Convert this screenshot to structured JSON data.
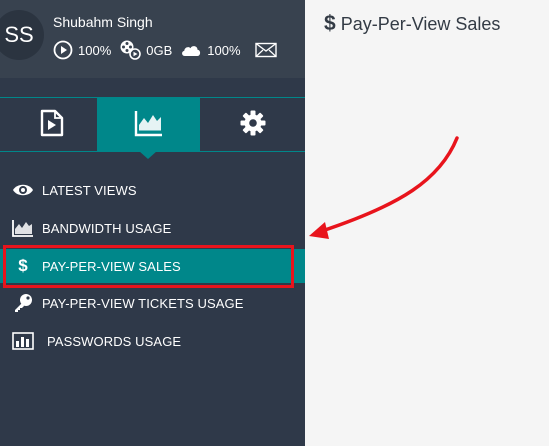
{
  "user": {
    "initials": "SS",
    "name": "Shubahm Singh",
    "video_quota": "100%",
    "bandwidth": "0GB",
    "storage": "100%"
  },
  "tabs": [
    {
      "name": "videos",
      "icon": "play-file-icon",
      "active": false
    },
    {
      "name": "analytics",
      "icon": "area-chart-icon",
      "active": true
    },
    {
      "name": "settings",
      "icon": "gear-icon",
      "active": false
    }
  ],
  "menu": {
    "items": [
      {
        "label": "LATEST VIEWS",
        "icon": "eye-icon",
        "active": false
      },
      {
        "label": "BANDWIDTH USAGE",
        "icon": "area-chart-icon",
        "active": false
      },
      {
        "label": "PAY-PER-VIEW SALES",
        "icon": "dollar-icon",
        "active": true
      },
      {
        "label": "PAY-PER-VIEW TICKETS USAGE",
        "icon": "key-icon",
        "active": false
      },
      {
        "label": "PASSWORDS USAGE",
        "icon": "bar-chart-icon",
        "active": false
      }
    ]
  },
  "main": {
    "title_icon": "$",
    "title": "Pay-Per-View Sales"
  },
  "colors": {
    "sidebar_bg": "#2f3949",
    "profile_bg": "#38424f",
    "accent": "#00878a",
    "annotation_red": "#e8141c",
    "content_bg": "#f5f5f5"
  }
}
